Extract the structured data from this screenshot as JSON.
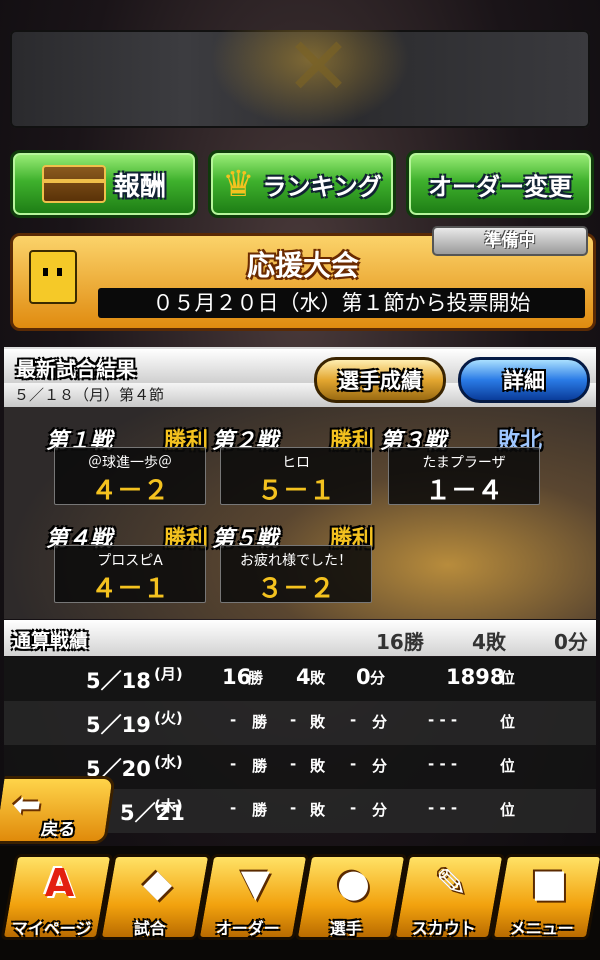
{
  "buttons": {
    "reward_label": "報酬",
    "ranking_label": "ランキング",
    "order_change_label": "オーダー変更"
  },
  "event": {
    "title": "応援大会",
    "status_badge": "準備中",
    "schedule_text": "０５月２０日（水）第１節から投票開始"
  },
  "results": {
    "title": "最新試合結果",
    "date_text": "５／１８（月）第４節",
    "player_stats_label": "選手成績",
    "detail_label": "詳細",
    "games": [
      {
        "label": "第１戦",
        "result": "勝利",
        "opponent": "＠球進一歩＠",
        "score": "４－２",
        "result_color": "#f4c21f",
        "score_color": "#f4c21f"
      },
      {
        "label": "第２戦",
        "result": "勝利",
        "opponent": "ヒロ",
        "score": "５－１",
        "result_color": "#f4c21f",
        "score_color": "#f4c21f"
      },
      {
        "label": "第３戦",
        "result": "敗北",
        "opponent": "たまプラーザ",
        "score": "１－４",
        "result_color": "#9fc7ff",
        "score_color": "#ffffff"
      },
      {
        "label": "第４戦",
        "result": "勝利",
        "opponent": "プロスピA",
        "score": "４－１",
        "result_color": "#f4c21f",
        "score_color": "#f4c21f"
      },
      {
        "label": "第５戦",
        "result": "勝利",
        "opponent": "お疲れ様でした！",
        "score": "３－２",
        "result_color": "#f4c21f",
        "score_color": "#f4c21f"
      }
    ]
  },
  "record": {
    "title": "通算戦績",
    "wins": "16勝",
    "losses": "4敗",
    "draws": "0分",
    "rows": [
      {
        "date": "5／18",
        "dow": "(月)",
        "w": "16",
        "wu": "勝",
        "l": "4",
        "lu": "敗",
        "d": "0",
        "du": "分",
        "rank": "1898",
        "ru": "位"
      },
      {
        "date": "5／19",
        "dow": "(火)",
        "w": "-",
        "wu": "勝",
        "l": "-",
        "lu": "敗",
        "d": "-",
        "du": "分",
        "rank": "- - -",
        "ru": "位"
      },
      {
        "date": "5／20",
        "dow": "(水)",
        "w": "-",
        "wu": "勝",
        "l": "-",
        "lu": "敗",
        "d": "-",
        "du": "分",
        "rank": "- - -",
        "ru": "位"
      },
      {
        "date": "5／21",
        "dow": "(木)",
        "w": "-",
        "wu": "勝",
        "l": "-",
        "lu": "敗",
        "d": "-",
        "du": "分",
        "rank": "- - -",
        "ru": "位"
      }
    ]
  },
  "back_label": "戻る",
  "nav": [
    {
      "label": "マイページ",
      "icon": "A"
    },
    {
      "label": "試合",
      "icon": "◆"
    },
    {
      "label": "オーダー",
      "icon": "▼"
    },
    {
      "label": "選手",
      "icon": "●"
    },
    {
      "label": "スカウト",
      "icon": "✎"
    },
    {
      "label": "メニュー",
      "icon": "■"
    }
  ]
}
